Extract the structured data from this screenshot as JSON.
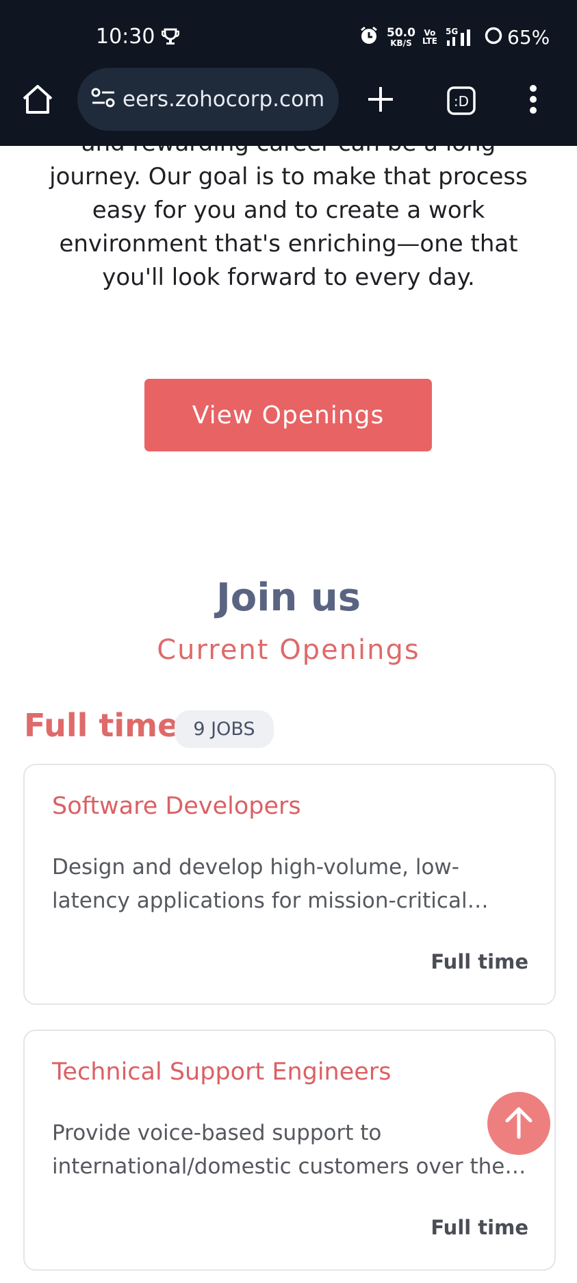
{
  "status_bar": {
    "time": "10:30",
    "net_speed_value": "50.0",
    "net_speed_unit": "KB/S",
    "volte_top": "Vo",
    "volte_bottom": "LTE",
    "network_type": "5G",
    "battery_percent": "65%"
  },
  "browser": {
    "url": "eers.zohocorp.com",
    "tab_switcher_label": ":D"
  },
  "intro": {
    "text": "and rewarding career can be a long journey. Our goal is to make that process easy for you and to create a work environment that's enriching—one that you'll look forward to every day."
  },
  "cta": {
    "view_openings_label": "View Openings"
  },
  "section": {
    "title": "Join us",
    "subtitle": "Current Openings"
  },
  "category": {
    "name": "Full time",
    "jobs_count": "9 JOBS"
  },
  "jobs": [
    {
      "title": "Software Developers",
      "description": "Design and develop high-volume, low-latency applications for mission-critical systems, delivering high availability and performance.",
      "type": "Full time"
    },
    {
      "title": "Technical Support Engineers",
      "description": "Provide voice-based support to international/domestic customers over the phone and email.",
      "type": "Full time"
    }
  ],
  "colors": {
    "accent": "#e86364",
    "heading": "#5a6482",
    "toolbar_bg": "#0f1521"
  }
}
